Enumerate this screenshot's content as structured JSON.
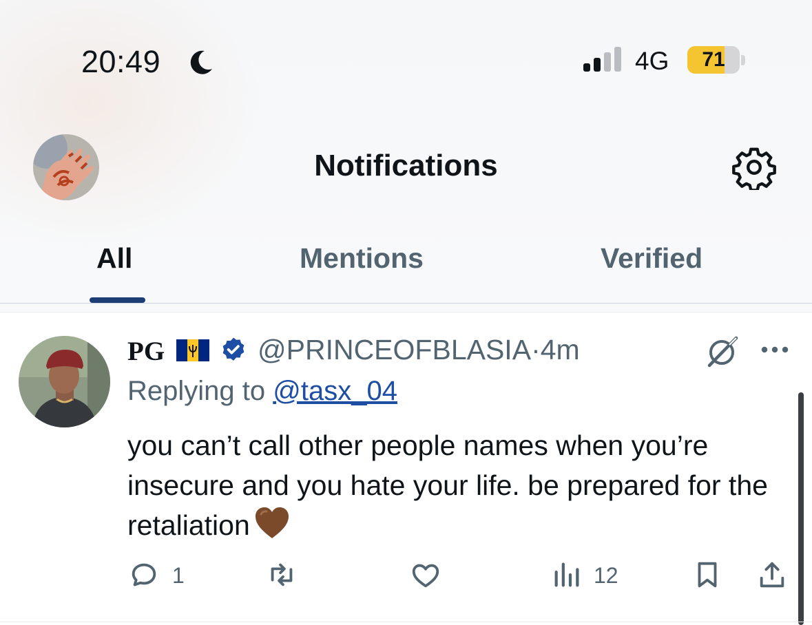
{
  "status_bar": {
    "time": "20:49",
    "network": "4G",
    "battery_level": "71",
    "battery_fraction": 0.71,
    "battery_color": "#f4c531"
  },
  "nav": {
    "title": "Notifications",
    "profile_icon": "avatar",
    "settings_icon": "gear-icon"
  },
  "tabs": [
    {
      "label": "All",
      "active": true
    },
    {
      "label": "Mentions",
      "active": false
    },
    {
      "label": "Verified",
      "active": false
    }
  ],
  "tweet": {
    "author_name": "PG",
    "author_flag": "barbados-flag-icon",
    "handle": "@PRINCEOFBLASIA",
    "separator": "·",
    "time": "4m",
    "replying_prefix": "Replying to",
    "replying_to": "@tasx_04",
    "text": "you can’t call other people names when you’re insecure and you hate your life. be prepared for the retaliation",
    "emoji": "brown-heart-icon",
    "reply_count": "1",
    "retweet_count": "",
    "like_count": "",
    "view_count": "12"
  },
  "colors": {
    "accent": "#1d3e74",
    "verified": "#1d4ea3",
    "text_secondary": "#536471"
  }
}
